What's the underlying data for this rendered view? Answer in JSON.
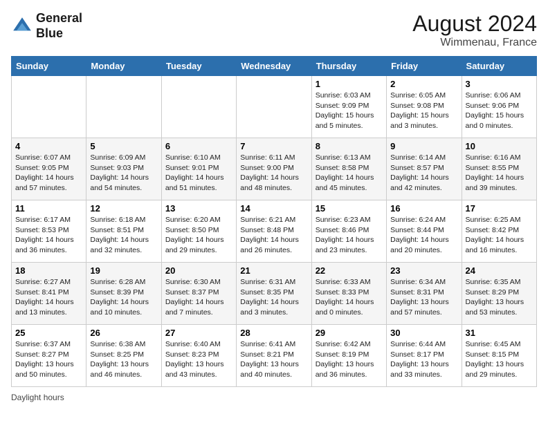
{
  "header": {
    "logo_line1": "General",
    "logo_line2": "Blue",
    "month_year": "August 2024",
    "location": "Wimmenau, France"
  },
  "days_of_week": [
    "Sunday",
    "Monday",
    "Tuesday",
    "Wednesday",
    "Thursday",
    "Friday",
    "Saturday"
  ],
  "footer": {
    "label": "Daylight hours"
  },
  "weeks": [
    [
      {
        "day": "",
        "info": ""
      },
      {
        "day": "",
        "info": ""
      },
      {
        "day": "",
        "info": ""
      },
      {
        "day": "",
        "info": ""
      },
      {
        "day": "1",
        "info": "Sunrise: 6:03 AM\nSunset: 9:09 PM\nDaylight: 15 hours\nand 5 minutes."
      },
      {
        "day": "2",
        "info": "Sunrise: 6:05 AM\nSunset: 9:08 PM\nDaylight: 15 hours\nand 3 minutes."
      },
      {
        "day": "3",
        "info": "Sunrise: 6:06 AM\nSunset: 9:06 PM\nDaylight: 15 hours\nand 0 minutes."
      }
    ],
    [
      {
        "day": "4",
        "info": "Sunrise: 6:07 AM\nSunset: 9:05 PM\nDaylight: 14 hours\nand 57 minutes."
      },
      {
        "day": "5",
        "info": "Sunrise: 6:09 AM\nSunset: 9:03 PM\nDaylight: 14 hours\nand 54 minutes."
      },
      {
        "day": "6",
        "info": "Sunrise: 6:10 AM\nSunset: 9:01 PM\nDaylight: 14 hours\nand 51 minutes."
      },
      {
        "day": "7",
        "info": "Sunrise: 6:11 AM\nSunset: 9:00 PM\nDaylight: 14 hours\nand 48 minutes."
      },
      {
        "day": "8",
        "info": "Sunrise: 6:13 AM\nSunset: 8:58 PM\nDaylight: 14 hours\nand 45 minutes."
      },
      {
        "day": "9",
        "info": "Sunrise: 6:14 AM\nSunset: 8:57 PM\nDaylight: 14 hours\nand 42 minutes."
      },
      {
        "day": "10",
        "info": "Sunrise: 6:16 AM\nSunset: 8:55 PM\nDaylight: 14 hours\nand 39 minutes."
      }
    ],
    [
      {
        "day": "11",
        "info": "Sunrise: 6:17 AM\nSunset: 8:53 PM\nDaylight: 14 hours\nand 36 minutes."
      },
      {
        "day": "12",
        "info": "Sunrise: 6:18 AM\nSunset: 8:51 PM\nDaylight: 14 hours\nand 32 minutes."
      },
      {
        "day": "13",
        "info": "Sunrise: 6:20 AM\nSunset: 8:50 PM\nDaylight: 14 hours\nand 29 minutes."
      },
      {
        "day": "14",
        "info": "Sunrise: 6:21 AM\nSunset: 8:48 PM\nDaylight: 14 hours\nand 26 minutes."
      },
      {
        "day": "15",
        "info": "Sunrise: 6:23 AM\nSunset: 8:46 PM\nDaylight: 14 hours\nand 23 minutes."
      },
      {
        "day": "16",
        "info": "Sunrise: 6:24 AM\nSunset: 8:44 PM\nDaylight: 14 hours\nand 20 minutes."
      },
      {
        "day": "17",
        "info": "Sunrise: 6:25 AM\nSunset: 8:42 PM\nDaylight: 14 hours\nand 16 minutes."
      }
    ],
    [
      {
        "day": "18",
        "info": "Sunrise: 6:27 AM\nSunset: 8:41 PM\nDaylight: 14 hours\nand 13 minutes."
      },
      {
        "day": "19",
        "info": "Sunrise: 6:28 AM\nSunset: 8:39 PM\nDaylight: 14 hours\nand 10 minutes."
      },
      {
        "day": "20",
        "info": "Sunrise: 6:30 AM\nSunset: 8:37 PM\nDaylight: 14 hours\nand 7 minutes."
      },
      {
        "day": "21",
        "info": "Sunrise: 6:31 AM\nSunset: 8:35 PM\nDaylight: 14 hours\nand 3 minutes."
      },
      {
        "day": "22",
        "info": "Sunrise: 6:33 AM\nSunset: 8:33 PM\nDaylight: 14 hours\nand 0 minutes."
      },
      {
        "day": "23",
        "info": "Sunrise: 6:34 AM\nSunset: 8:31 PM\nDaylight: 13 hours\nand 57 minutes."
      },
      {
        "day": "24",
        "info": "Sunrise: 6:35 AM\nSunset: 8:29 PM\nDaylight: 13 hours\nand 53 minutes."
      }
    ],
    [
      {
        "day": "25",
        "info": "Sunrise: 6:37 AM\nSunset: 8:27 PM\nDaylight: 13 hours\nand 50 minutes."
      },
      {
        "day": "26",
        "info": "Sunrise: 6:38 AM\nSunset: 8:25 PM\nDaylight: 13 hours\nand 46 minutes."
      },
      {
        "day": "27",
        "info": "Sunrise: 6:40 AM\nSunset: 8:23 PM\nDaylight: 13 hours\nand 43 minutes."
      },
      {
        "day": "28",
        "info": "Sunrise: 6:41 AM\nSunset: 8:21 PM\nDaylight: 13 hours\nand 40 minutes."
      },
      {
        "day": "29",
        "info": "Sunrise: 6:42 AM\nSunset: 8:19 PM\nDaylight: 13 hours\nand 36 minutes."
      },
      {
        "day": "30",
        "info": "Sunrise: 6:44 AM\nSunset: 8:17 PM\nDaylight: 13 hours\nand 33 minutes."
      },
      {
        "day": "31",
        "info": "Sunrise: 6:45 AM\nSunset: 8:15 PM\nDaylight: 13 hours\nand 29 minutes."
      }
    ]
  ]
}
